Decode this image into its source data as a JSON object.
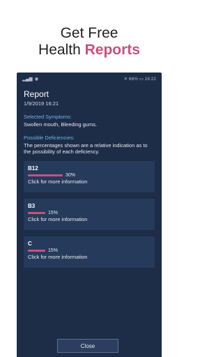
{
  "headline": {
    "line1": "Get Free",
    "line2_prefix": "Health ",
    "line2_accent": "Reports"
  },
  "statusbar": {
    "battery": "66%",
    "time": "16:22"
  },
  "report": {
    "title": "Report",
    "date": "1/9/2019 16:21",
    "symptoms_label": "Selected Symptoms:",
    "symptoms": "Swollen mouth, Bleeding gums.",
    "deficiencies_label": "Possible Deficiencies:",
    "deficiencies_note": "The percentages shown are a relative indication as to the possibility of each deficiency.",
    "items": [
      {
        "name": "B12",
        "percent_text": "30%",
        "level": 0.3,
        "more": "Click for more information"
      },
      {
        "name": "B3",
        "percent_text": "15%",
        "level": 0.15,
        "more": "Click for more information"
      },
      {
        "name": "C",
        "percent_text": "15%",
        "level": 0.15,
        "more": "Click for more information"
      }
    ]
  },
  "buttons": {
    "close": "Close"
  },
  "colors": {
    "accent": "#c8507e",
    "background": "#1d2c47",
    "card": "#263a5b",
    "link": "#6fb3e8"
  }
}
